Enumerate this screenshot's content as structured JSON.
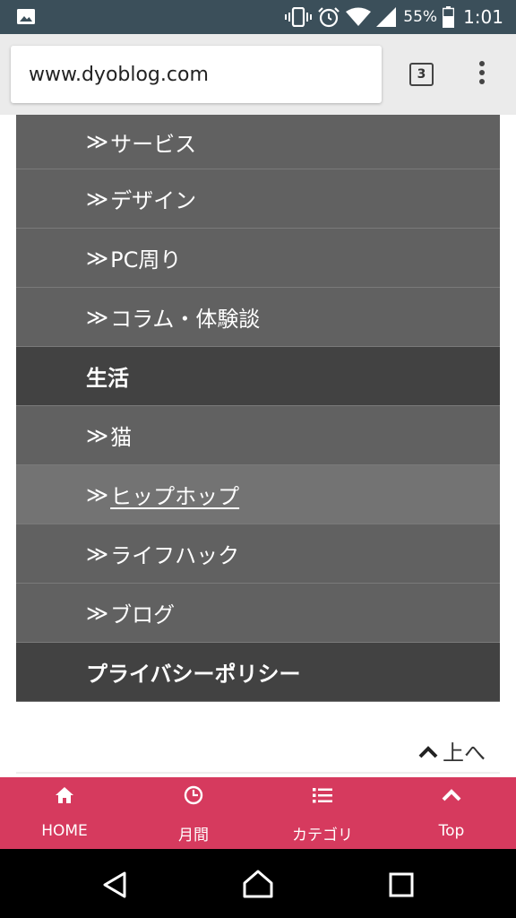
{
  "status_bar": {
    "battery_percent": "55%",
    "time": "1:01",
    "icons": [
      "image-icon",
      "vibrate-icon",
      "alarm-icon",
      "wifi-icon",
      "signal-icon",
      "battery-icon"
    ]
  },
  "browser": {
    "url": "www.dyoblog.com",
    "tab_count": "3"
  },
  "menu": {
    "items": [
      {
        "mark": "≫",
        "label": "サービス"
      },
      {
        "mark": "≫",
        "label": "デザイン"
      },
      {
        "mark": "≫",
        "label": "PC周り"
      },
      {
        "mark": "≫",
        "label": "コラム・体験談"
      },
      {
        "label": "生活"
      },
      {
        "mark": "≫",
        "label": "猫"
      },
      {
        "mark": "≫",
        "label": "ヒップホップ"
      },
      {
        "mark": "≫",
        "label": "ライフハック"
      },
      {
        "mark": "≫",
        "label": "ブログ"
      },
      {
        "label": "プライバシーポリシー"
      }
    ]
  },
  "back_to_top": {
    "label": "上へ"
  },
  "bottom_nav": {
    "items": [
      {
        "label": "HOME",
        "icon": "home-icon"
      },
      {
        "label": "月間",
        "icon": "clock-icon"
      },
      {
        "label": "カテゴリ",
        "icon": "list-icon"
      },
      {
        "label": "Top",
        "icon": "chevron-up-icon"
      }
    ]
  },
  "colors": {
    "status_bar": "#3b4f5a",
    "menu_row": "#616161",
    "menu_header": "#424242",
    "menu_hover": "#737373",
    "bottom_nav": "#d63a5e"
  }
}
